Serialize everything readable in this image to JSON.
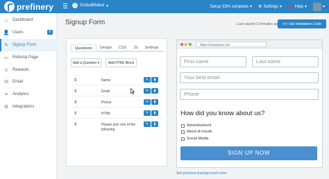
{
  "topbar": {
    "brand": "prefinery",
    "account": "GrabaBitabal",
    "setup": "Setup 33% complete",
    "settings": "Settings",
    "help": "Help"
  },
  "sidebar": {
    "items": [
      {
        "label": "Dashboard",
        "icon": "home-icon"
      },
      {
        "label": "Users",
        "icon": "users-icon",
        "badge": "6"
      },
      {
        "label": "Signup Form",
        "icon": "form-icon",
        "active": true
      },
      {
        "label": "Referral Page",
        "icon": "page-icon"
      },
      {
        "label": "Rewards",
        "icon": "rewards-icon"
      },
      {
        "label": "Email",
        "icon": "email-icon"
      },
      {
        "label": "Analytics",
        "icon": "analytics-icon"
      },
      {
        "label": "Integrations",
        "icon": "integrations-icon"
      }
    ]
  },
  "header": {
    "title": "Signup Form",
    "last_saved": "Last saved 3 minutes ago",
    "install_button": "Get Installation Code"
  },
  "builder": {
    "tabs": [
      "Questions",
      "Design",
      "CSS",
      "JS",
      "Settings"
    ],
    "add_question": "Add a Question",
    "add_html": "Add HTML Block",
    "fields": [
      "Name",
      "Email",
      "Phone",
      "HTML",
      "Please pick one of the following"
    ]
  },
  "preview": {
    "url": "https://zaasaman.com",
    "first_name": "First name",
    "last_name": "Last name",
    "email": "Your best email",
    "phone": "Phone",
    "question": "How did you know about us?",
    "options": [
      "Advertisement",
      "Word-of-mouth",
      "Social Media"
    ],
    "button": "SIGN UP NOW",
    "bg_link": "Set preview background color"
  },
  "colors": {
    "brand": "#2a84c6",
    "signup_button": "#4a8fd0",
    "dot_red": "#e9584e",
    "dot_yellow": "#f1b63c",
    "dot_green": "#5fbf50"
  }
}
